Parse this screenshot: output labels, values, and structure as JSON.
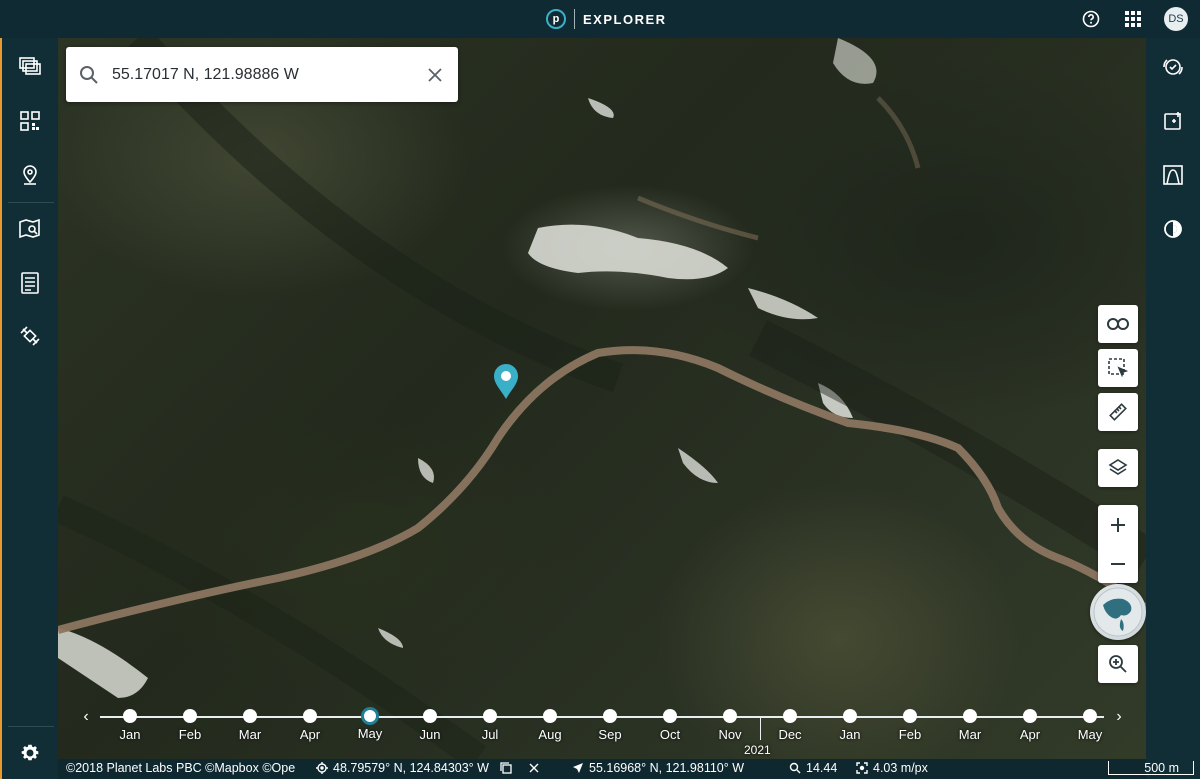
{
  "header": {
    "brand_letter": "p",
    "brand_name": "EXPLORER",
    "user_initials": "DS",
    "icons": [
      "help-icon",
      "apps-grid-icon"
    ]
  },
  "left_sidebar": {
    "items": [
      "mosaics-icon",
      "basemaps-icon",
      "places-icon",
      "map-search-icon",
      "orders-icon",
      "satellite-icon"
    ],
    "footer_icon": "settings-icon"
  },
  "right_sidebar": {
    "items": [
      "compare-icon",
      "analysis-icon",
      "elevation-icon",
      "contrast-icon"
    ]
  },
  "search": {
    "value": "55.17017 N, 121.98886 W"
  },
  "map_tools": [
    "link-icon",
    "select-area-icon",
    "ruler-icon",
    "layers-icon"
  ],
  "zoom": {
    "in": "+",
    "out": "−"
  },
  "timeline": {
    "months": [
      "Jan",
      "Feb",
      "Mar",
      "Apr",
      "May",
      "Jun",
      "Jul",
      "Aug",
      "Sep",
      "Oct",
      "Nov",
      "Dec",
      "Jan",
      "Feb",
      "Mar",
      "Apr",
      "May"
    ],
    "active_index": 4,
    "year_label": "2021"
  },
  "status": {
    "attribution": "©2018 Planet Labs PBC ©Mapbox ©Ope",
    "cursor_coords": "48.79579° N, 124.84303° W",
    "center_coords": "55.16968° N, 121.98110° W",
    "zoom_level": "14.44",
    "resolution": "4.03 m/px",
    "scale": "500 m"
  },
  "colors": {
    "chrome": "#102a33",
    "accent": "#3ab0c8",
    "sidebar_edge": "#e89a2e"
  }
}
